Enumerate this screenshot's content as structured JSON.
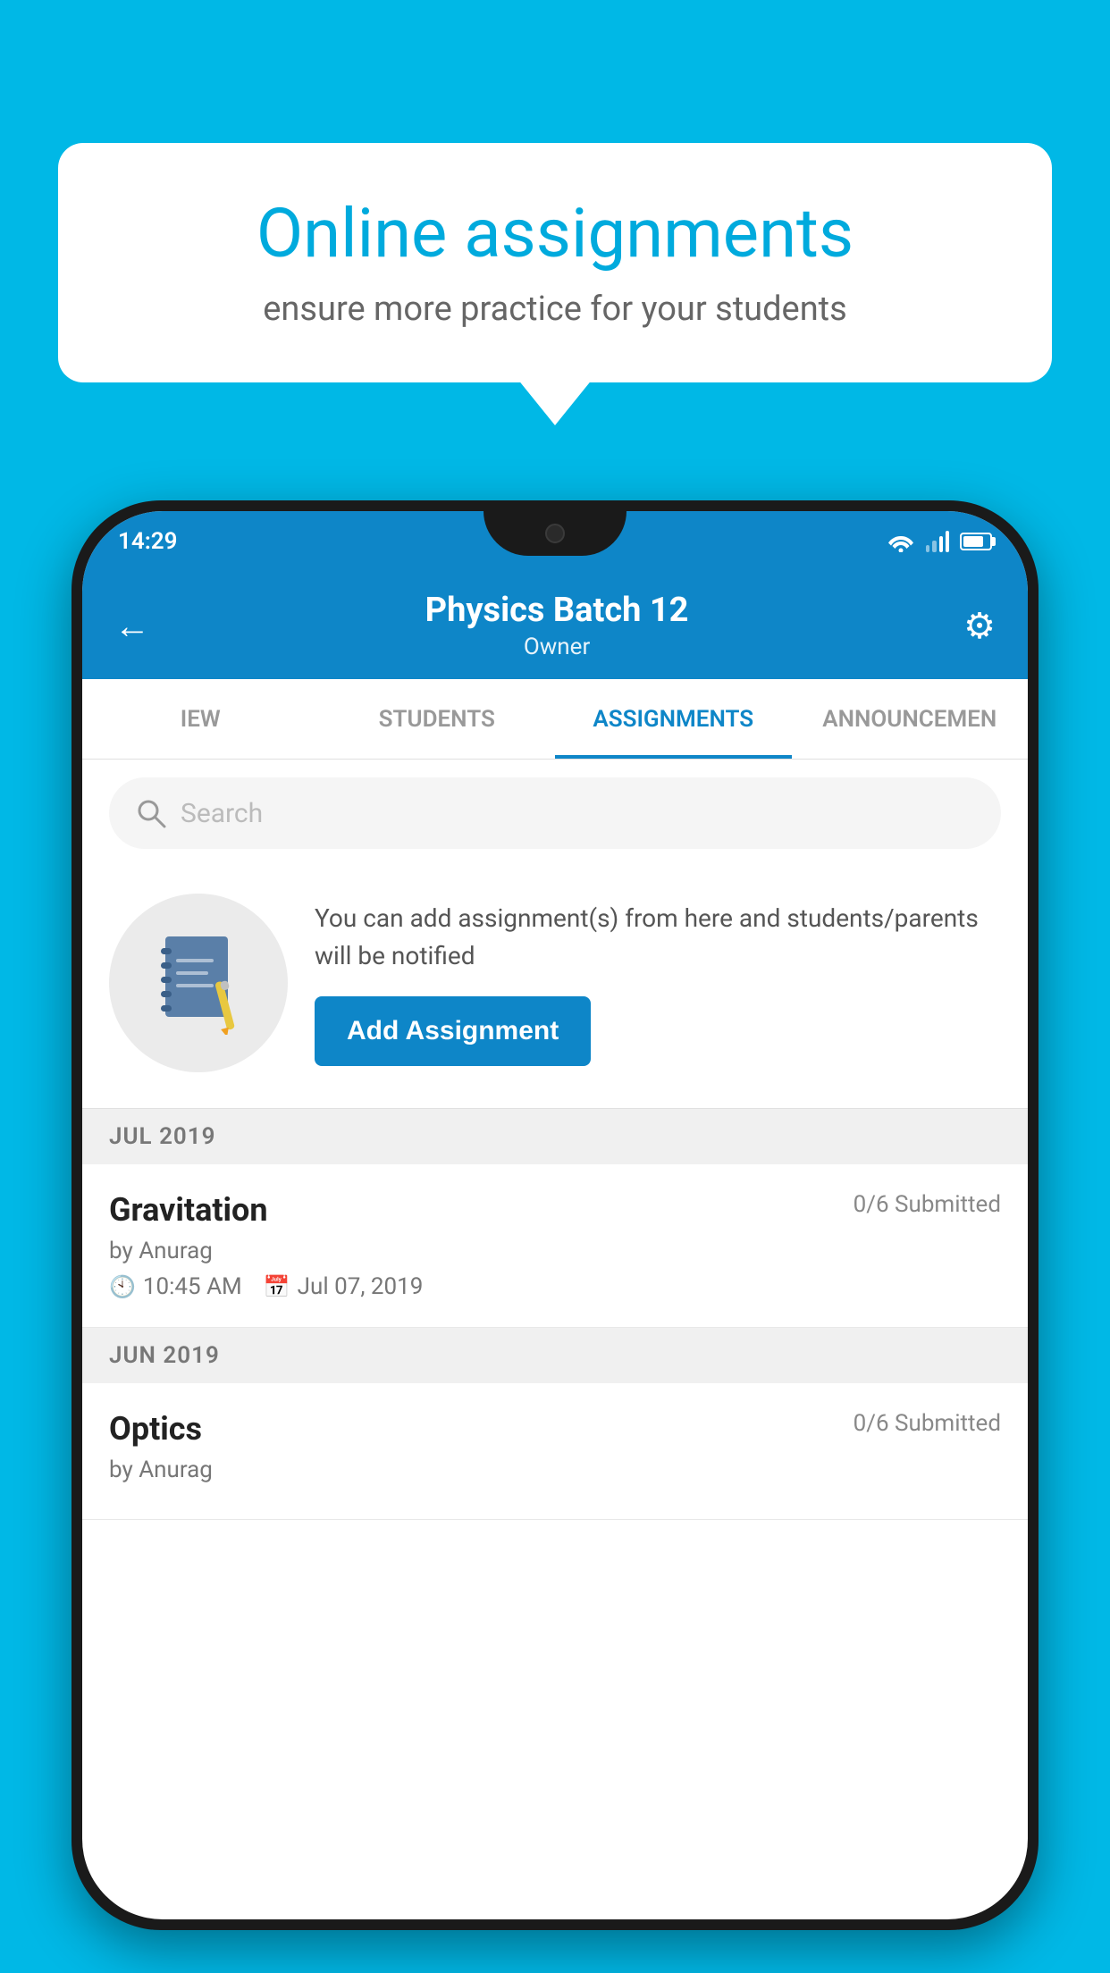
{
  "background_color": "#00b8e6",
  "speech_bubble": {
    "title": "Online assignments",
    "subtitle": "ensure more practice for your students"
  },
  "phone": {
    "status_bar": {
      "time": "14:29"
    },
    "header": {
      "title": "Physics Batch 12",
      "subtitle": "Owner",
      "back_label": "←",
      "settings_label": "⚙"
    },
    "tabs": [
      {
        "label": "IEW",
        "active": false
      },
      {
        "label": "STUDENTS",
        "active": false
      },
      {
        "label": "ASSIGNMENTS",
        "active": true
      },
      {
        "label": "ANNOUNCEMEN",
        "active": false
      }
    ],
    "search": {
      "placeholder": "Search"
    },
    "promo": {
      "description": "You can add assignment(s) from here and students/parents will be notified",
      "button_label": "Add Assignment"
    },
    "sections": [
      {
        "month": "JUL 2019",
        "assignments": [
          {
            "name": "Gravitation",
            "submitted": "0/6 Submitted",
            "author": "by Anurag",
            "time": "10:45 AM",
            "date": "Jul 07, 2019"
          }
        ]
      },
      {
        "month": "JUN 2019",
        "assignments": [
          {
            "name": "Optics",
            "submitted": "0/6 Submitted",
            "author": "by Anurag",
            "time": "",
            "date": ""
          }
        ]
      }
    ]
  }
}
